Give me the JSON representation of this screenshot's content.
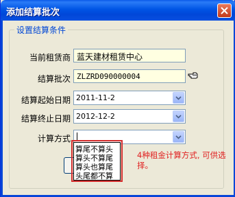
{
  "window": {
    "title": "添加结算批次",
    "colors": {
      "title_bar": "#0054E3",
      "group_title": "#0046D5",
      "field_yellow": "#FFFFE1",
      "annotation": "#E02020"
    }
  },
  "group": {
    "title": "设置结算条件"
  },
  "form": {
    "lessee_label": "当前租赁商",
    "lessee_value": "蓝天建材租赁中心",
    "batch_label": "结算批次",
    "batch_value": "ZLZRD090000004",
    "start_label": "结算起始日期",
    "start_value": "2011-11-2",
    "end_label": "结算终止日期",
    "end_value": "2012-12-2",
    "method_label": "计算方式",
    "method_value": ""
  },
  "method_options": [
    "算尾不算头",
    "算头不算尾",
    "算头也算尾",
    "头尾都不算"
  ],
  "annotation": "4种租金计算方式, 可供选择。",
  "icons": {
    "close": "close-icon",
    "pick": "hand-pointer-icon",
    "dropdown": "chevron-down-icon"
  }
}
